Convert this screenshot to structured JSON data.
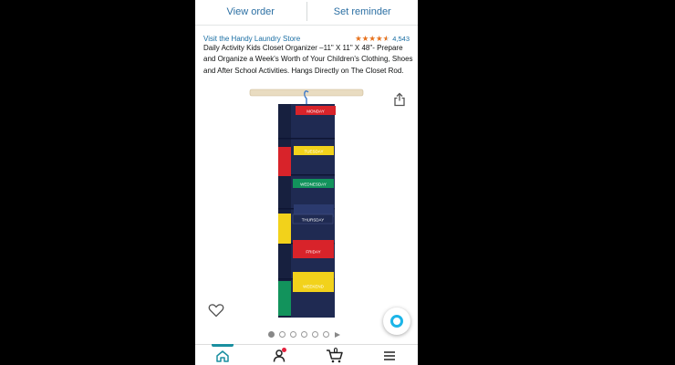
{
  "order_bar": {
    "view_order": "View order",
    "set_reminder": "Set reminder"
  },
  "product": {
    "store_link": "Visit the Handy Laundry Store",
    "rating_count": "4,543",
    "title": "Daily Activity Kids Closet Organizer –11\" X 11\" X 48\"- Prepare and Organize a Week's Worth of Your Children's Clothing, Shoes and After School Activities. Hangs Directly on The Closet Rod.",
    "image_labels": {
      "monday": "MONDAY",
      "tuesday": "TUESDAY",
      "wednesday": "WEDNESDAY",
      "thursday": "THURSDAY",
      "friday": "FRIDAY",
      "weekend": "WEEKEND"
    }
  },
  "carousel": {
    "page_count": 6,
    "active_index": 0,
    "has_video": true
  },
  "bottom_nav": {
    "cart_count": "0"
  },
  "icons": [
    "share-icon",
    "heart-icon",
    "alexa-icon",
    "home-icon",
    "account-icon",
    "cart-icon",
    "menu-icon",
    "play-icon"
  ],
  "colors": {
    "link": "#1a6ea3",
    "star": "#e7711b",
    "alexa": "#1cb5e8",
    "nav_accent": "#1a8fa0",
    "organizer_navy": "#1f2a52",
    "tag_red": "#d8232a",
    "tag_yellow": "#f2d21b",
    "tag_green": "#12935c"
  }
}
